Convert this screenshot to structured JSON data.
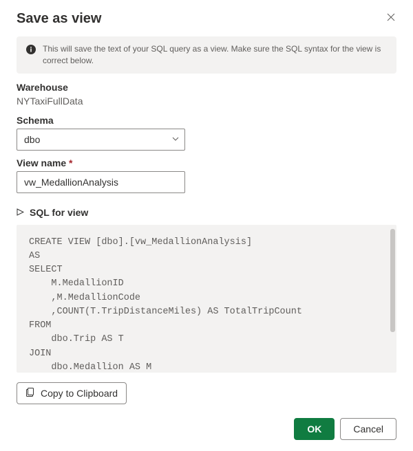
{
  "dialog": {
    "title": "Save as view",
    "info": "This will save the text of your SQL query as a view. Make sure the SQL syntax for the view is correct below."
  },
  "fields": {
    "warehouse_label": "Warehouse",
    "warehouse_value": "NYTaxiFullData",
    "schema_label": "Schema",
    "schema_value": "dbo",
    "viewname_label": "View name",
    "viewname_value": "vw_MedallionAnalysis",
    "sql_label": "SQL for view"
  },
  "sql": "CREATE VIEW [dbo].[vw_MedallionAnalysis]\nAS\nSELECT\n    M.MedallionID\n    ,M.MedallionCode\n    ,COUNT(T.TripDistanceMiles) AS TotalTripCount\nFROM\n    dbo.Trip AS T\nJOIN\n    dbo.Medallion AS M",
  "buttons": {
    "copy": "Copy to Clipboard",
    "ok": "OK",
    "cancel": "Cancel"
  }
}
